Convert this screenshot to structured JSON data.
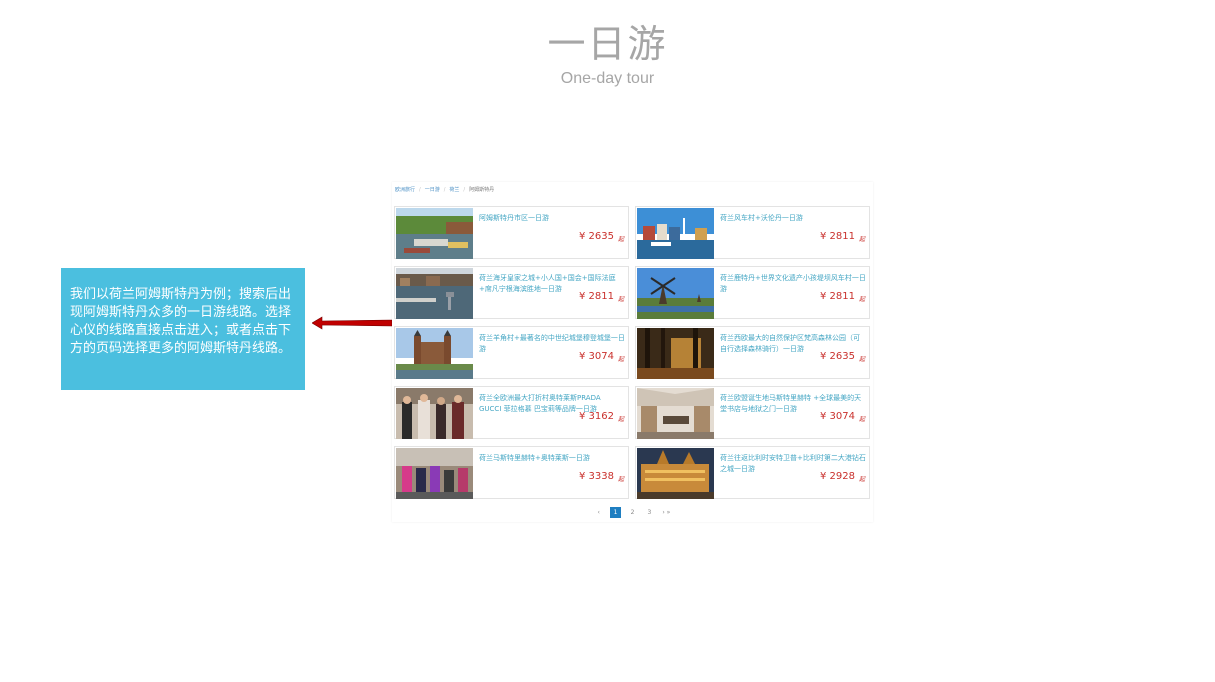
{
  "slide": {
    "title": "一日游",
    "subtitle": "One-day tour",
    "callout_text": "我们以荷兰阿姆斯特丹为例；搜索后出现阿姆斯特丹众多的一日游线路。选择心仪的线路直接点击进入；或者点击下方的页码选择更多的阿姆斯特丹线路。",
    "callout_color": "#4bbfdf",
    "arrow_color": "#c00000"
  },
  "screenshot": {
    "breadcrumb": [
      "欧洲旅行",
      "一日游",
      "荷兰",
      "阿姆斯特丹"
    ],
    "currency": "¥",
    "price_suffix": "起",
    "price_color": "#c9302c",
    "name_color": "#46a7c4",
    "cards": [
      {
        "name": "阿姆斯特丹市区一日游",
        "price": "2635",
        "thumb": "canal-photo"
      },
      {
        "name": "荷兰风车村+沃伦丹一日游",
        "price": "2811",
        "thumb": "harbor-photo"
      },
      {
        "name": "荷兰海牙皇家之城+小人国+国会+国际法庭+席凡宁根海滨胜地一日游",
        "price": "2811",
        "thumb": "heron-canal-photo"
      },
      {
        "name": "荷兰鹿特丹+世界文化遗产小孩堤坝风车村一日游",
        "price": "2811",
        "thumb": "windmill-photo"
      },
      {
        "name": "荷兰羊角村+最著名的中世纪城堡穆登城堡一日游",
        "price": "3074",
        "thumb": "castle-photo"
      },
      {
        "name": "荷兰西欧最大的自然保护区梵高森林公园（可自行选择森林骑行）一日游",
        "price": "2635",
        "thumb": "forest-photo"
      },
      {
        "name": "荷兰全欧洲最大打折村奥特莱斯PRADA GUCCI 菲拉格慕 巴宝莉等品牌一日游",
        "price": "3162",
        "thumb": "shoppers-photo"
      },
      {
        "name": "荷兰欧盟诞生地马斯特里赫特 +全球最美的天堂书店与地狱之门一日游",
        "price": "3074",
        "thumb": "bookstore-photo"
      },
      {
        "name": "荷兰马斯特里赫特+奥特莱斯一日游",
        "price": "3338",
        "thumb": "street-photo"
      },
      {
        "name": "荷兰往返比利时安特卫普+比利时第二大港钻石之城一日游",
        "price": "2928",
        "thumb": "night-city-photo"
      }
    ],
    "pager": {
      "prev": "‹",
      "pages": [
        "1",
        "2",
        "3"
      ],
      "active": "1",
      "next": "› »"
    }
  }
}
